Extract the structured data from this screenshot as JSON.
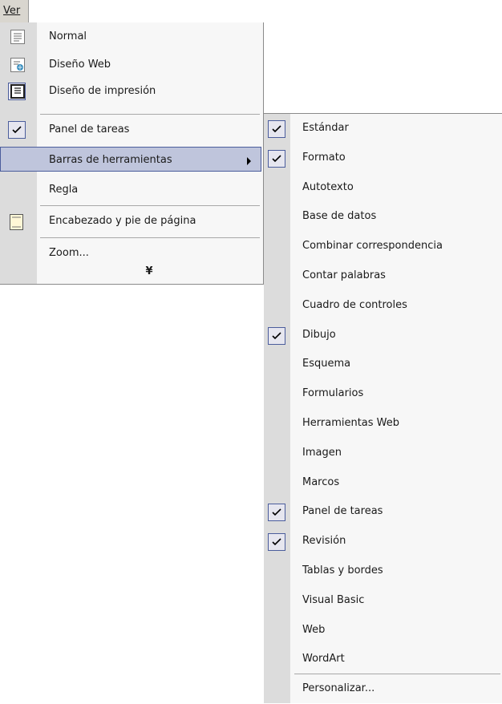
{
  "menubar": {
    "ver_label": "Ver"
  },
  "main_menu": {
    "items": [
      {
        "label": "Normal",
        "icon": "normal-view-icon"
      },
      {
        "label": "Diseño Web",
        "icon": "web-layout-icon"
      },
      {
        "label": "Diseño de impresión",
        "icon": "print-layout-icon"
      },
      {
        "label": "Panel de tareas",
        "checked": true
      },
      {
        "label": "Barras de herramientas",
        "highlighted": true,
        "submenu": true
      },
      {
        "label": "Regla"
      },
      {
        "label": "Encabezado y pie de página",
        "icon": "header-footer-icon"
      },
      {
        "label": "Zoom..."
      }
    ],
    "expand_glyph": "¥"
  },
  "sub_menu": {
    "items": [
      {
        "label": "Estándar",
        "checked": true
      },
      {
        "label": "Formato",
        "checked": true
      },
      {
        "label": "Autotexto",
        "checked": false
      },
      {
        "label": "Base de datos",
        "checked": false
      },
      {
        "label": "Combinar correspondencia",
        "checked": false
      },
      {
        "label": "Contar palabras",
        "checked": false
      },
      {
        "label": "Cuadro de controles",
        "checked": false
      },
      {
        "label": "Dibujo",
        "checked": true
      },
      {
        "label": "Esquema",
        "checked": false
      },
      {
        "label": "Formularios",
        "checked": false
      },
      {
        "label": "Herramientas Web",
        "checked": false
      },
      {
        "label": "Imagen",
        "checked": false
      },
      {
        "label": "Marcos",
        "checked": false
      },
      {
        "label": "Panel de tareas",
        "checked": true
      },
      {
        "label": "Revisión",
        "checked": true
      },
      {
        "label": "Tablas y bordes",
        "checked": false
      },
      {
        "label": "Visual Basic",
        "checked": false
      },
      {
        "label": "Web",
        "checked": false
      },
      {
        "label": "WordArt",
        "checked": false
      },
      {
        "label": "Personalizar...",
        "checked": false
      }
    ]
  },
  "colors": {
    "highlight": "#bfc5dc",
    "highlight_border": "#4b5d9c",
    "gutter": "#dcdcdc"
  }
}
